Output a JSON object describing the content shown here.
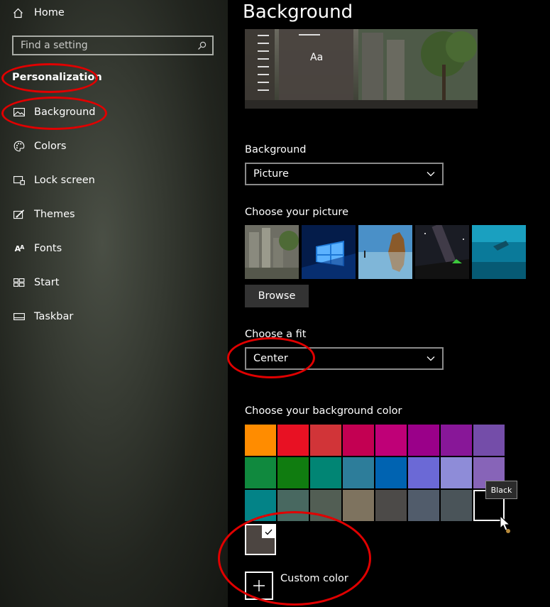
{
  "sidebar": {
    "home_label": "Home",
    "search_placeholder": "Find a setting",
    "section_title": "Personalization",
    "items": [
      {
        "label": "Background",
        "icon": "picture-icon"
      },
      {
        "label": "Colors",
        "icon": "palette-icon"
      },
      {
        "label": "Lock screen",
        "icon": "lock-screen-icon"
      },
      {
        "label": "Themes",
        "icon": "brush-icon"
      },
      {
        "label": "Fonts",
        "icon": "font-icon"
      },
      {
        "label": "Start",
        "icon": "start-icon"
      },
      {
        "label": "Taskbar",
        "icon": "taskbar-icon"
      }
    ]
  },
  "main": {
    "title": "Background",
    "preview": {
      "sample_text": "Aa"
    },
    "background_label": "Background",
    "background_value": "Picture",
    "choose_picture_label": "Choose your picture",
    "browse_label": "Browse",
    "fit_label": "Choose a fit",
    "fit_value": "Center",
    "color_label": "Choose your background color",
    "color_tooltip": "Black",
    "custom_color_label": "Custom color"
  },
  "colors": {
    "row1": [
      "#ff8c00",
      "#e81123",
      "#d13438",
      "#c30052",
      "#bf0077",
      "#9a0089",
      "#881798",
      "#744da9"
    ],
    "row2": [
      "#10893e",
      "#107c10",
      "#018574",
      "#2d7d9a",
      "#0063b1",
      "#6b69d6",
      "#8e8cd8",
      "#8764b8"
    ],
    "row3": [
      "#038387",
      "#486860",
      "#525e54",
      "#7e735f",
      "#4c4a48",
      "#515c6b",
      "#4a5459",
      "#000000"
    ],
    "selected": "#4c4541",
    "accent_annotation": "#e00000"
  }
}
